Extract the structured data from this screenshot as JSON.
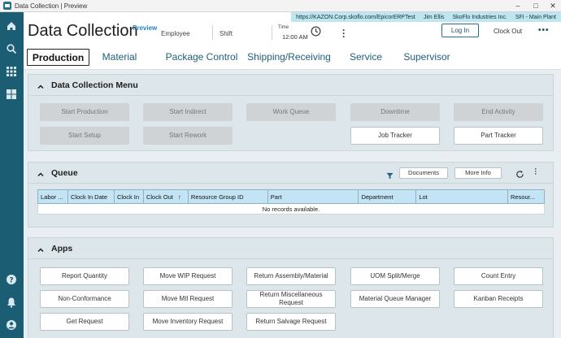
{
  "window": {
    "title": "Data Collection | Preview"
  },
  "env": {
    "url": "https://KAZON.Corp.skoflo.com/EpicorERPTest",
    "user": "Jim Ellis",
    "company": "SkoFlo Industries Inc.",
    "plant": "SFI - Main Plant"
  },
  "header": {
    "title": "Data Collection",
    "preview": "Preview",
    "employee_label": "Employee",
    "shift_label": "Shift",
    "time_label": "Time",
    "time_value": "12:00 AM",
    "login_label": "Log In",
    "clockout_label": "Clock Out"
  },
  "tabs": [
    {
      "label": "Production"
    },
    {
      "label": "Material"
    },
    {
      "label": "Package Control"
    },
    {
      "label": "Shipping/Receiving"
    },
    {
      "label": "Service"
    },
    {
      "label": "Supervisor"
    }
  ],
  "menu": {
    "title": "Data Collection Menu",
    "items": [
      {
        "label": "Start Production"
      },
      {
        "label": "Start Indirect"
      },
      {
        "label": "Work Queue"
      },
      {
        "label": "Downtime"
      },
      {
        "label": "End Activity"
      },
      {
        "label": "Start Setup"
      },
      {
        "label": "Start Rework"
      },
      {
        "label": "Job Tracker"
      },
      {
        "label": "Part Tracker"
      }
    ]
  },
  "queue": {
    "title": "Queue",
    "documents_label": "Documents",
    "more_info_label": "More Info",
    "columns": [
      "Labor ...",
      "Clock In Date",
      "Clock In",
      "Clock Out",
      "Resource Group ID",
      "Part",
      "Department",
      "Lot",
      "Resour..."
    ],
    "sort_indicator": "↑",
    "empty_text": "No records available."
  },
  "apps": {
    "title": "Apps",
    "items": [
      {
        "label": "Report Quantity"
      },
      {
        "label": "Move WIP Request"
      },
      {
        "label": "Return Assembly/Material"
      },
      {
        "label": "UOM Split/Merge"
      },
      {
        "label": "Count Entry"
      },
      {
        "label": "Non-Conformance"
      },
      {
        "label": "Move Mtl Request"
      },
      {
        "label": "Return Miscellaneous Request"
      },
      {
        "label": "Material Queue Manager"
      },
      {
        "label": "Kanban Receipts"
      },
      {
        "label": "Get Request"
      },
      {
        "label": "Move Inventory Request"
      },
      {
        "label": "Return Salvage Request"
      }
    ]
  },
  "icons": {
    "rail": [
      "home-icon",
      "search-icon",
      "apps-grid-icon",
      "dashboard-icon",
      "help-icon",
      "notifications-icon",
      "user-icon"
    ],
    "accent": "#1b5e73",
    "header_fill": "#c3e4f5"
  }
}
